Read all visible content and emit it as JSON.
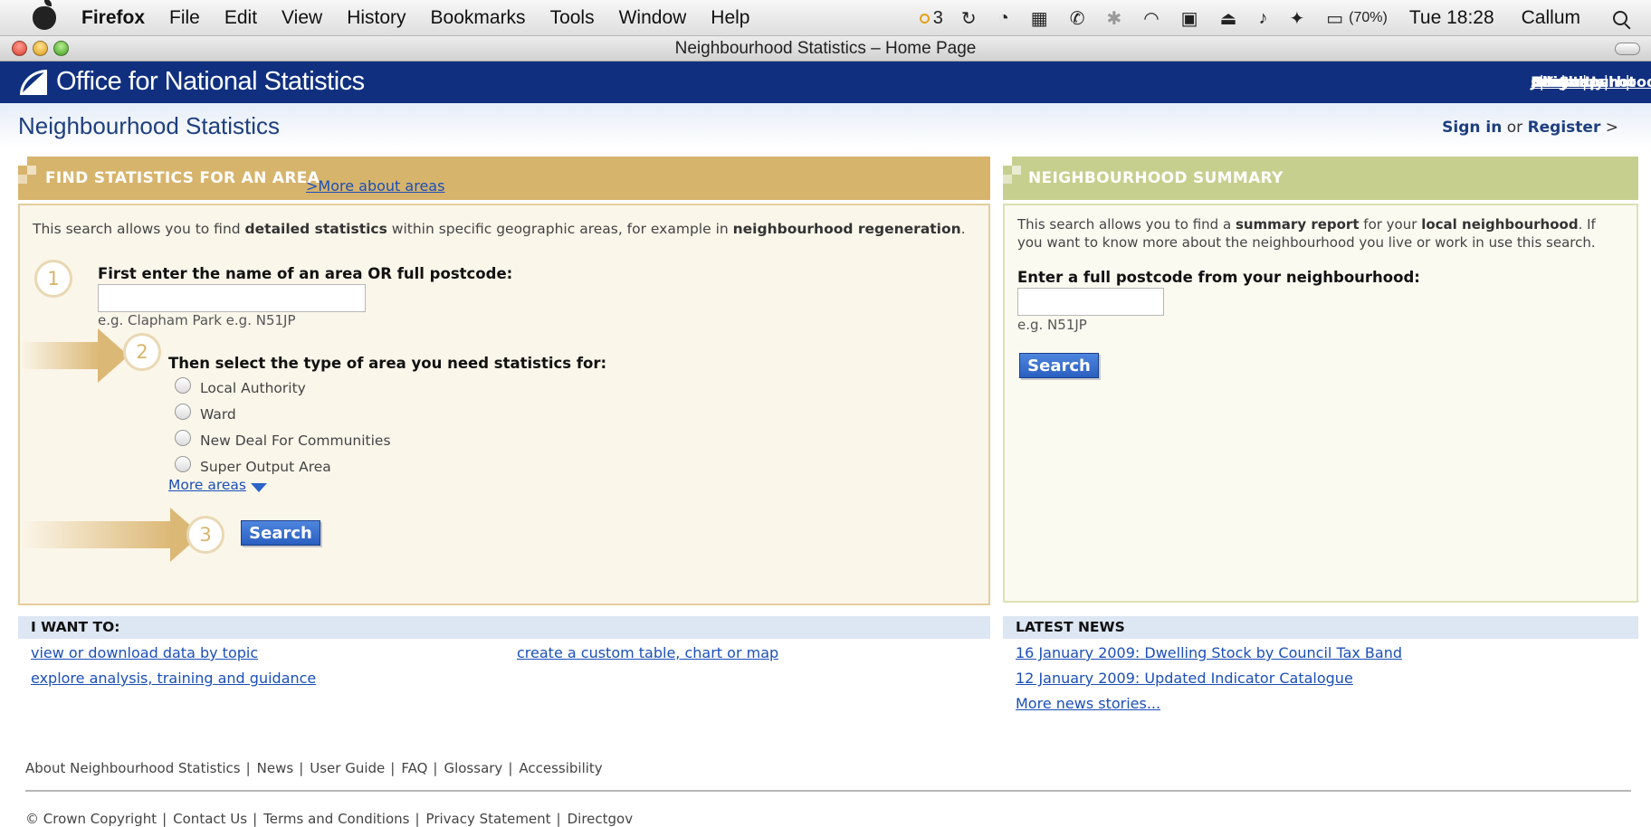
{
  "menubar": {
    "app": "Firefox",
    "items": [
      "File",
      "Edit",
      "View",
      "History",
      "Bookmarks",
      "Tools",
      "Window",
      "Help"
    ],
    "tray_count": "3",
    "battery": "(70%)",
    "clock": "Tue 18:28",
    "user": "Callum"
  },
  "window": {
    "title": "Neighbourhood Statistics – Home Page"
  },
  "ons": {
    "org_name": "Office for National Statistics",
    "nav": [
      "UK Snapshot",
      "Neighbourhood",
      "Economy",
      "Census",
      "About Us",
      "Jobs"
    ],
    "nav_sep": "|"
  },
  "page": {
    "title": "Neighbourhood Statistics",
    "signin": "Sign in",
    "or": "or",
    "register": "Register",
    "register_arrow": ">"
  },
  "find": {
    "heading": "FIND STATISTICS FOR AN AREA",
    "more_about": ">More about areas",
    "intro_1": "This search allows you to find ",
    "intro_b1": "detailed statistics",
    "intro_2": " within specific geographic areas, for example in ",
    "intro_b2": "neighbourhood regeneration",
    "intro_3": ".",
    "step1_num": "1",
    "step1_label": "First enter the name of an area OR full postcode:",
    "step1_value": "",
    "step1_hint": "e.g. Clapham Park e.g. N51JP",
    "step2_num": "2",
    "step2_label": "Then select the type of area you need statistics for:",
    "area_types": [
      "Local Authority",
      "Ward",
      "New Deal For Communities",
      "Super Output Area"
    ],
    "more_areas": "More areas",
    "step3_num": "3",
    "search_label": "Search"
  },
  "summary": {
    "heading": "NEIGHBOURHOOD SUMMARY",
    "intro_1": "This search allows you to find a ",
    "intro_b1": "summary report",
    "intro_2": " for your ",
    "intro_b2": "local neighbourhood",
    "intro_3": ". If",
    "intro_line2": "you want to know more about the neighbourhood you live or work in use this search.",
    "postcode_label": "Enter a full postcode from your neighbourhood:",
    "postcode_value": "",
    "hint": "e.g. N51JP",
    "search_label": "Search"
  },
  "i_want": {
    "heading": "I WANT TO:",
    "links": [
      "view or download data by topic",
      "explore analysis, training and guidance",
      "create a custom table, chart or map"
    ]
  },
  "news": {
    "heading": "LATEST NEWS",
    "items": [
      "16 January 2009: Dwelling Stock by Council Tax Band",
      "12 January 2009: Updated Indicator Catalogue"
    ],
    "more": "More news stories..."
  },
  "footer": {
    "row1": [
      "About Neighbourhood Statistics",
      "News",
      "User Guide",
      "FAQ",
      "Glossary",
      "Accessibility"
    ],
    "row2": [
      "© Crown Copyright",
      "Contact Us",
      "Terms and Conditions",
      "Privacy Statement",
      "Directgov"
    ],
    "sep": "|"
  },
  "colors": {
    "ons_blue": "#10307f",
    "find_header": "#d7b46c",
    "summary_header": "#c7cf8e",
    "link": "#1b4fb8",
    "button": "#2a5fc0"
  }
}
